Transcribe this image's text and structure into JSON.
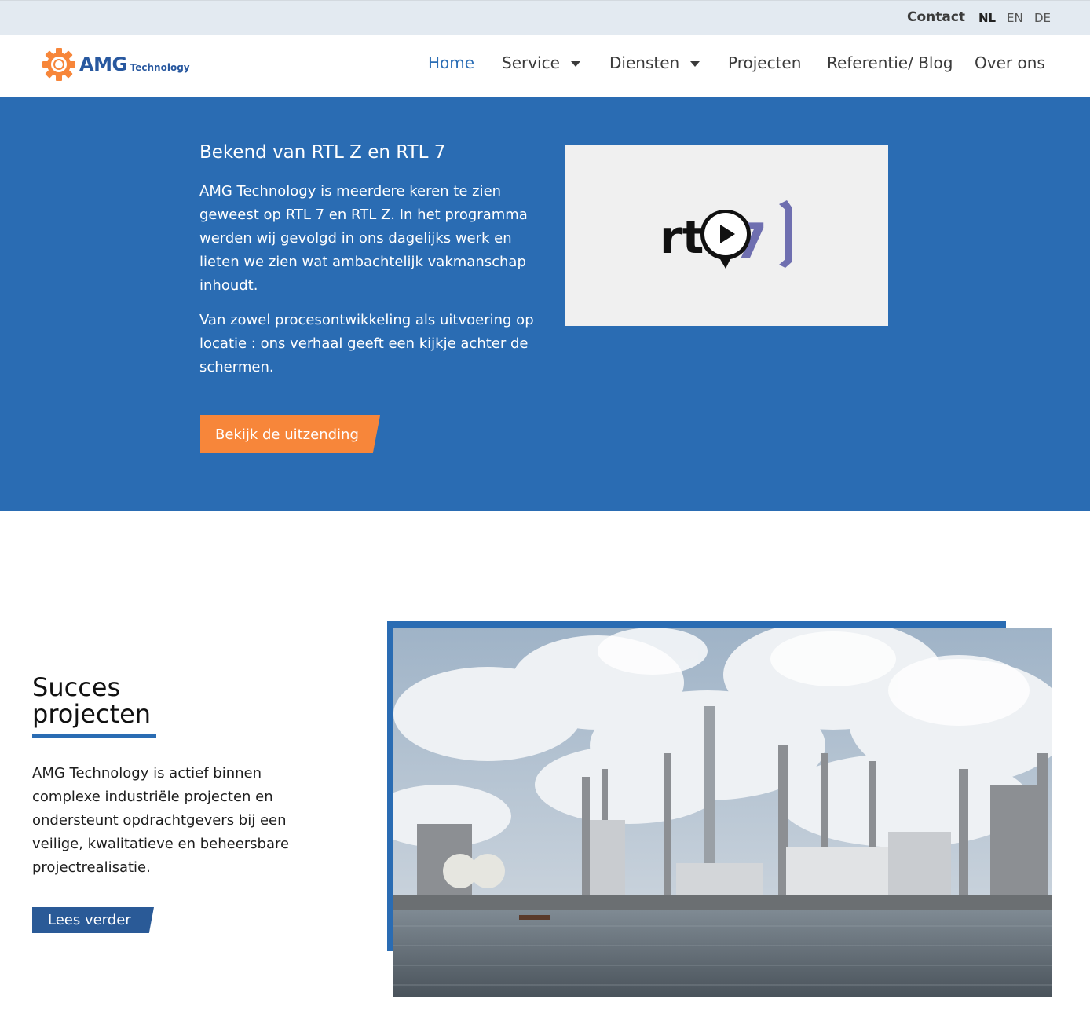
{
  "topbar": {
    "contact": "Contact",
    "languages": [
      "NL",
      "EN",
      "DE"
    ],
    "active_language": "NL"
  },
  "header": {
    "logo_text": "AMG",
    "logo_subtext": "Technology",
    "nav": [
      {
        "label": "Home",
        "active": true
      },
      {
        "label": "Service",
        "dropdown": true
      },
      {
        "label": "Diensten",
        "dropdown": true
      },
      {
        "label": "Projecten"
      },
      {
        "label": "Referentie/ Blog"
      },
      {
        "label": "Over ons"
      }
    ]
  },
  "hero": {
    "title": "Bekend van RTL Z en RTL 7",
    "paragraph1": "AMG Technology  is meerdere keren te zien geweest op RTL 7 en RTL Z. In het programma werden wij gevolgd in ons dagelijks werk en lieten we zien wat ambachtelijk vakmanschap inhoudt.",
    "paragraph2": "Van zowel procesontwikkeling als uitvoering op locatie : ons verhaal geeft een kijkje achter de schermen.",
    "button": "Bekijk de uitzending",
    "video_logo": "rtl 7"
  },
  "projects": {
    "title_line1": "Succes",
    "title_line2": "projecten",
    "text": "AMG Technology is actief binnen complexe industriële projecten en ondersteunt opdrachtgevers bij een veilige, kwalitatieve en beheersbare projectrealisatie.",
    "button": "Lees verder"
  },
  "colors": {
    "primary_blue": "#2a6cb3",
    "accent_orange": "#f7863a",
    "button_blue": "#2a5a97",
    "topbar": "#e3eaf1"
  },
  "icons": [
    "gear-logo-icon",
    "caret-down-icon",
    "play-icon"
  ]
}
